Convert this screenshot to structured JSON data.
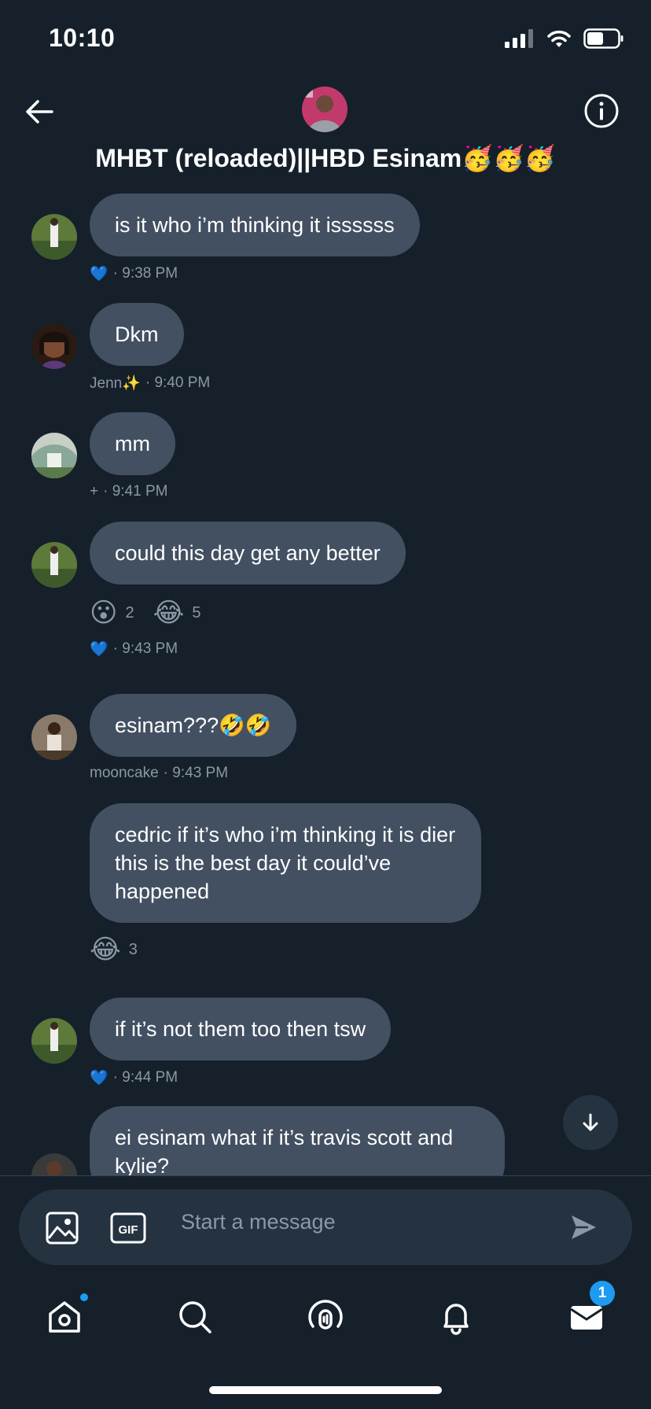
{
  "status_bar": {
    "time": "10:10"
  },
  "header": {
    "title": "MHBT (reloaded)||HBD Esinam🥳🥳🥳"
  },
  "messages": [
    {
      "text": "is it who i’m thinking it issssss",
      "meta_name": "💙",
      "time": "· 9:38 PM"
    },
    {
      "text": "Dkm",
      "meta_name": "Jenn✨",
      "time": "· 9:40 PM"
    },
    {
      "text": "mm",
      "meta_name": "+",
      "time": "· 9:41 PM"
    },
    {
      "text": "could this day get any better",
      "meta_name": "💙",
      "time": "· 9:43 PM",
      "reactions": [
        {
          "emoji": "😮",
          "count": "2"
        },
        {
          "emoji": "😂",
          "count": "5"
        }
      ]
    },
    {
      "text": "esinam???🤣🤣",
      "meta_name": "mooncake",
      "time": "· 9:43 PM"
    },
    {
      "text": "cedric if it’s who i’m thinking it is dier this is the best day it could’ve happened",
      "reactions": [
        {
          "emoji": "😂",
          "count": "3"
        }
      ]
    },
    {
      "text": "if it’s not them too then tsw",
      "meta_name": "💙",
      "time": "· 9:44 PM"
    },
    {
      "text": "ei esinam what if it’s travis scott and kylie?"
    }
  ],
  "composer": {
    "placeholder": "Start a message",
    "gif_label": "GIF"
  },
  "tabbar": {
    "messages_badge": "1"
  },
  "colors": {
    "background": "#15202b",
    "bubble": "#425062",
    "accent": "#1d9bf0"
  },
  "icons": [
    "back-arrow-icon",
    "info-icon",
    "image-icon",
    "gif-icon",
    "send-icon",
    "home-icon",
    "search-icon",
    "spaces-icon",
    "bell-icon",
    "mail-icon",
    "arrow-down-icon"
  ]
}
